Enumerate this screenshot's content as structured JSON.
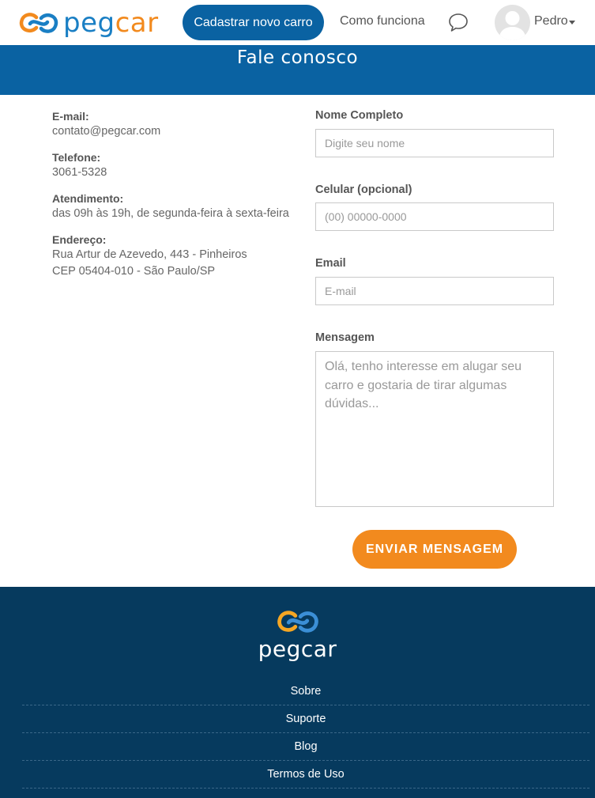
{
  "navbar": {
    "logo_peg": "peg",
    "logo_car": "car",
    "cadastrar_label": "Cadastrar novo carro",
    "como_funciona_label": "Como funciona",
    "user_name": "Pedro"
  },
  "banner": {
    "title": "Fale conosco"
  },
  "info": {
    "email_label": "E-mail:",
    "email_value": "contato@pegcar.com",
    "telefone_label": "Telefone:",
    "telefone_value": "3061-5328",
    "atendimento_label": "Atendimento:",
    "atendimento_value": "das 09h às 19h, de segunda-feira à sexta-feira",
    "endereco_label": "Endereço:",
    "endereco_line1": "Rua Artur de Azevedo, 443 - Pinheiros",
    "endereco_line2": "CEP 05404-010 - São Paulo/SP"
  },
  "form": {
    "nome_label": "Nome Completo",
    "nome_placeholder": "Digite seu nome",
    "celular_label": "Celular (opcional)",
    "celular_placeholder": "(00) 00000-0000",
    "email_label": "Email",
    "email_placeholder": "E-mail",
    "mensagem_label": "Mensagem",
    "mensagem_placeholder": "Olá, tenho interesse em alugar seu carro e gostaria de tirar algumas dúvidas...",
    "send_label": "ENVIAR MENSAGEM"
  },
  "footer": {
    "logo_text": "pegcar",
    "links": [
      "Sobre",
      "Suporte",
      "Blog",
      "Termos de Uso"
    ]
  },
  "colors": {
    "brand_blue": "#0a62a2",
    "brand_orange": "#f28a1e",
    "footer_bg": "#063a5e"
  }
}
